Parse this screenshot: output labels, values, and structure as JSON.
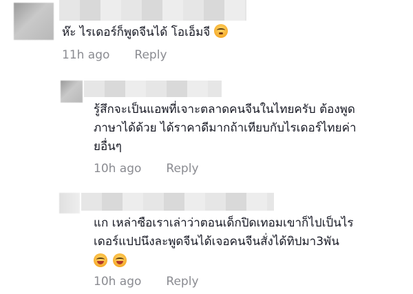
{
  "comments": [
    {
      "text_lines": [
        "ห๊ะ ไรเดอร์ก็พูดจีนได้ โอเอ็มจี"
      ],
      "emojis": [
        "flushed-face"
      ],
      "time": "11h ago",
      "reply": "Reply"
    },
    {
      "text_lines": [
        "รู้สึกจะเป็นแอพที่เจาะตลาดคนจีนในไทยครับ ต้องพูด",
        "ภาษาได้ด้วย ได้ราคาดีมากถ้าเทียบกับไรเดอร์ไทยค่า",
        "ยอื่นๆ"
      ],
      "time": "10h ago",
      "reply": "Reply"
    },
    {
      "text_lines": [
        "แก เหล่าซือเราเล่าว่าตอนเด็กปิดเทอมเขาก็ไปเป็นไร",
        "เดอร์แปปนึงละพูดจีนได้เจอคนจีนสั่งได้ทิปมา3พัน"
      ],
      "emojis": [
        "laughing-face",
        "laughing-face"
      ],
      "time": "10h ago",
      "reply": "Reply"
    }
  ]
}
